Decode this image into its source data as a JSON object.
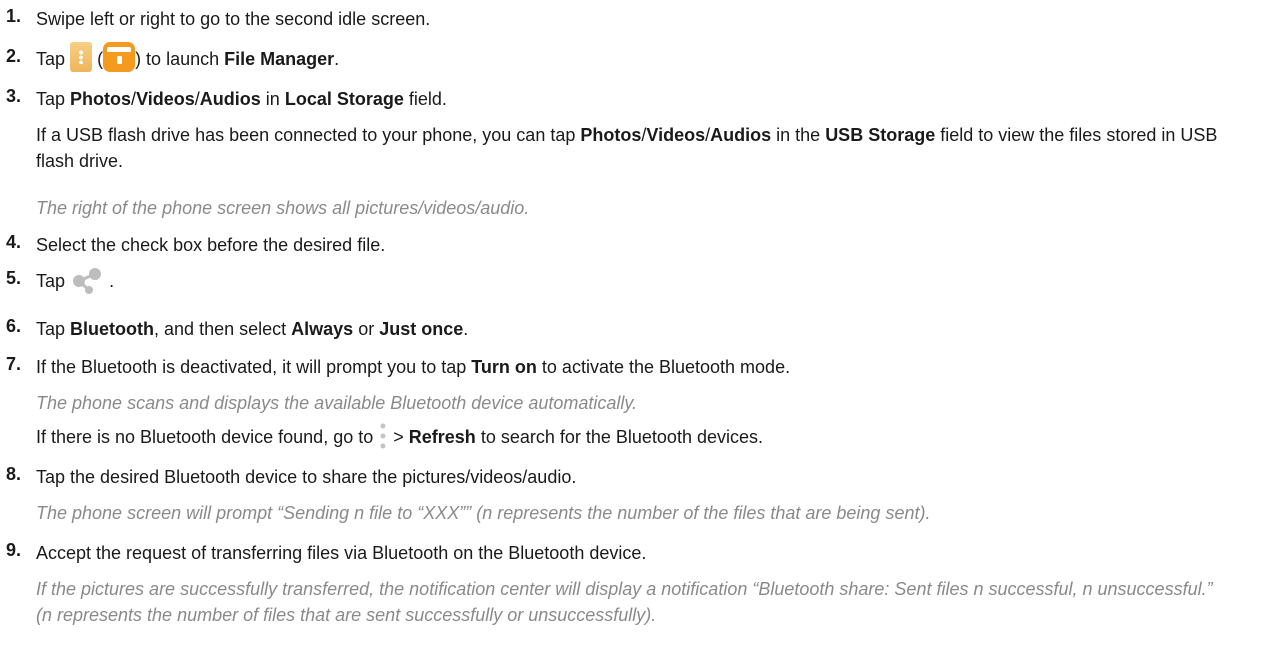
{
  "steps": [
    {
      "num": "1.",
      "parts": [
        "Swipe left or right to go to the second idle screen."
      ]
    },
    {
      "num": "2.",
      "parts": [
        "Tap",
        "(",
        ") to launch",
        "File Manager",
        "."
      ]
    },
    {
      "num": "3.",
      "parts": [
        "Tap",
        "Photos",
        "/",
        "Videos",
        "/",
        "Audios",
        "in",
        "Local Storage",
        "field."
      ],
      "sub": {
        "parts": [
          "If a USB flash drive has been connected to your phone, you can tap",
          "Photos",
          "/",
          "Videos",
          "/",
          "Audios",
          "in the",
          "USB Storage",
          "field to view the files stored in USB flash drive."
        ]
      },
      "note": "The right of the phone screen shows all pictures/videos/audio."
    },
    {
      "num": "4.",
      "parts": [
        "Select the check box before the desired file."
      ]
    },
    {
      "num": "5.",
      "parts": [
        "Tap",
        "."
      ]
    },
    {
      "num": "6.",
      "parts": [
        "Tap",
        "Bluetooth",
        ", and then select",
        "Always",
        "or",
        "Just once",
        "."
      ]
    },
    {
      "num": "7.",
      "parts": [
        "If the Bluetooth is deactivated, it will prompt you to tap",
        "Turn on",
        "to activate the Bluetooth mode."
      ],
      "note": "The phone scans and displays the available Bluetooth device automatically.",
      "sub": {
        "parts": [
          "If there is no Bluetooth device found, go to",
          "> ",
          "Refresh",
          "to search for the Bluetooth devices."
        ]
      }
    },
    {
      "num": "8.",
      "parts": [
        "Tap the desired Bluetooth device to share the pictures/videos/audio."
      ],
      "note": "The phone screen will prompt “Sending n file to “XXX”” (n represents the number of the files that are being sent)."
    },
    {
      "num": "9.",
      "parts": [
        "Accept the request of transferring files via Bluetooth on the Bluetooth device."
      ],
      "note": "If the pictures are successfully transferred, the notification center will display a notification “Bluetooth share: Sent files n successful, n unsuccessful.” (n represents the number of files that are sent successfully or unsuccessfully)."
    }
  ],
  "icons": {
    "menu_tile": "menu-more-icon",
    "file_manager": "file-manager-icon",
    "share": "share-icon",
    "menu_dots": "more-options-icon"
  },
  "colors": {
    "note_text": "#8a8a8a",
    "file_manager_orange": "#f39a1f",
    "menu_tile_yellow": "#f2c06b",
    "share_gray": "#bdbdbd"
  }
}
